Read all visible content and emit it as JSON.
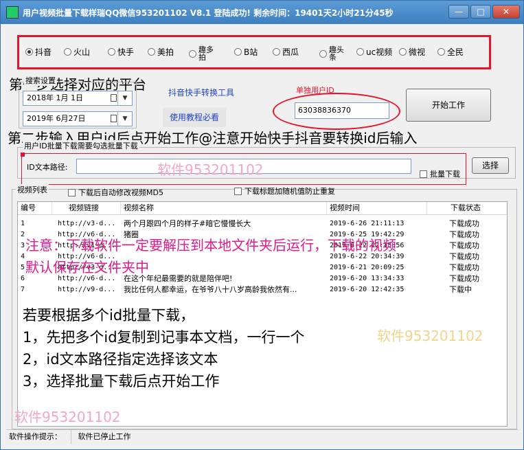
{
  "window": {
    "title": "用户视频批量下载样瑞QQ微信953201102    V8.1    登陆成功! 剩余时间：19401天2小时21分45秒",
    "minimize": "—",
    "maximize": "□",
    "close": "✕"
  },
  "platforms": [
    {
      "label": "抖音",
      "selected": true
    },
    {
      "label": "火山",
      "selected": false
    },
    {
      "label": "快手",
      "selected": false
    },
    {
      "label": "美拍",
      "selected": false
    },
    {
      "label": "趣多拍",
      "selected": false
    },
    {
      "label": "B站",
      "selected": false
    },
    {
      "label": "西瓜",
      "selected": false
    },
    {
      "label": "趣头条",
      "selected": false
    },
    {
      "label": "uc视频",
      "selected": false
    },
    {
      "label": "微视",
      "selected": false
    },
    {
      "label": "全民",
      "selected": false
    }
  ],
  "overlay": {
    "step1": "第一步选择对应的平台",
    "step2": "第二步输入用户id后点开始工作@注意开始快手抖音要转换id后输入",
    "watermark_mid": "软件953201102",
    "notice_line1": "注意：下载软件一定要解压到本地文件夹后运行，下载的视频",
    "notice_line2": "默认保存在文件夹中",
    "batch_line1": "若要根据多个id批量下载，",
    "batch_line2": "1，先把多个id复制到记事本文档，一行一个",
    "batch_line3": "2，id文本路径指定选择该文本",
    "batch_line4": "3，选择批量下载后点开始工作",
    "watermark_right": "软件953201102",
    "watermark_left": "软件953201102"
  },
  "search": {
    "group_label": "搜索设置",
    "date_start": "2018年 1月 1日",
    "date_end": "2019年 6月27日",
    "convert_tool": "抖音快手转换工具",
    "tutorial": "使用教程必看"
  },
  "single": {
    "label": "单独用户ID",
    "value": "63038836370",
    "start_button": "开始工作"
  },
  "batch": {
    "group_label": "用户ID批量下载需要勾选批量下载",
    "path_label": "ID文本路径:",
    "path_value": "",
    "batch_checkbox": "批量下载",
    "select_button": "选择"
  },
  "videos": {
    "group_label": "视频列表",
    "option_md5": "下载后自动修改视频MD5",
    "option_random": "下载标题加随机值防止重复",
    "columns": [
      "编号",
      "视频链接",
      "视频名称",
      "视频时间",
      "下载状态"
    ],
    "rows": [
      {
        "no": "1",
        "link": "http://v3-d...",
        "name": "两个月跟四个月的样子#暗它慢慢长大",
        "time": "2019-6-26 21:11:13",
        "status": "下载成功"
      },
      {
        "no": "2",
        "link": "http://v6-d...",
        "name": "猪圈",
        "time": "2019-6-25 19:42:29",
        "status": "下载成功"
      },
      {
        "no": "3",
        "link": "http://v1-d...",
        "name": "",
        "time": "2019-6-22 22:15:56",
        "status": "下载成功"
      },
      {
        "no": "4",
        "link": "http://v6-d...",
        "name": "",
        "time": "2019-6-22 20:34:39",
        "status": "下载成功"
      },
      {
        "no": "5",
        "link": "http://v3-d...",
        "name": "",
        "time": "2019-6-21 20:09:25",
        "status": "下载成功"
      },
      {
        "no": "6",
        "link": "http://v6-d...",
        "name": "在这个年纪最需要的就是陪伴吧!",
        "time": "2019-6-20 13:34:33",
        "status": "下载成功"
      },
      {
        "no": "7",
        "link": "http://v9-d...",
        "name": "我比任何人都幸运，在爷爷八十八岁高龄我依然有...",
        "time": "2019-6-20 12:42:35",
        "status": "下载中"
      }
    ]
  },
  "statusbar": {
    "label": "软件操作提示：",
    "message": "软件已停止工作"
  },
  "colors": {
    "annotation_red": "#e8122b",
    "overlay_magenta": "#e0198c",
    "watermark_pink": "#f4a6c8",
    "watermark_gold": "#f2d48a"
  }
}
